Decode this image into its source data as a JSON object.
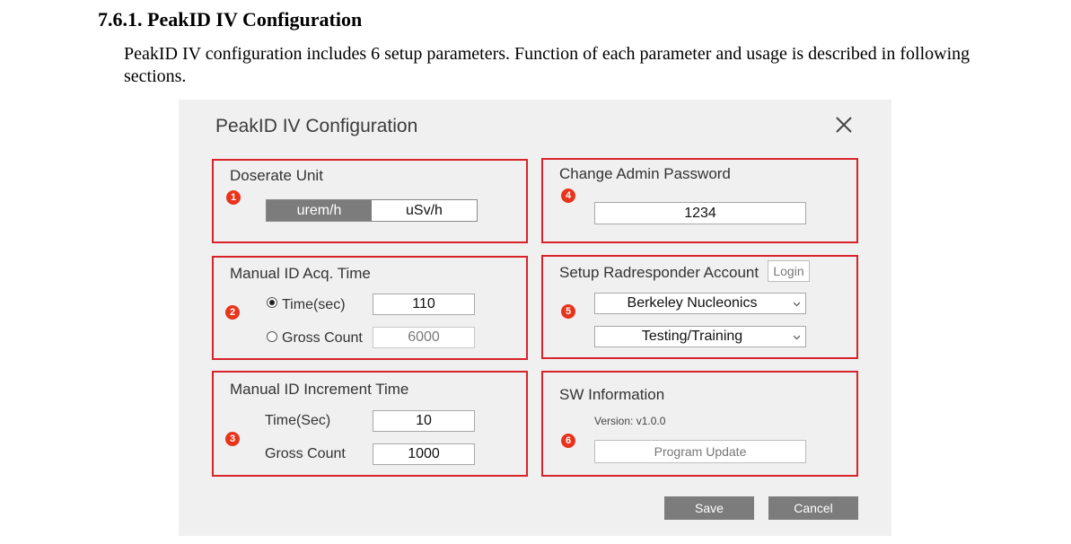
{
  "document": {
    "heading": "7.6.1. PeakID IV Configuration",
    "paragraph": "PeakID IV configuration includes 6 setup parameters. Function of each parameter and usage is described in following sections."
  },
  "dialog": {
    "title": "PeakID IV Configuration",
    "close_icon": "close-icon",
    "sections": {
      "doserate": {
        "title": "Doserate Unit",
        "badge": "1",
        "options": [
          "urem/h",
          "uSv/h"
        ],
        "selected": "urem/h"
      },
      "acq_time": {
        "title": "Manual ID Acq. Time",
        "badge": "2",
        "time_label": "Time(sec)",
        "time_value": "110",
        "gross_label": "Gross Count",
        "gross_value": "6000",
        "selected_option": "Time(sec)"
      },
      "increment": {
        "title": "Manual ID Increment Time",
        "badge": "3",
        "time_label": "Time(Sec)",
        "time_value": "10",
        "gross_label": "Gross Count",
        "gross_value": "1000"
      },
      "admin_password": {
        "title": "Change Admin Password",
        "badge": "4",
        "value": "1234"
      },
      "radresponder": {
        "title": "Setup Radresponder Account",
        "badge": "5",
        "login_label": "Login",
        "organization": "Berkeley Nucleonics",
        "event": "Testing/Training"
      },
      "sw_info": {
        "title": "SW Information",
        "badge": "6",
        "version": "Version: v1.0.0",
        "update_label": "Program Update"
      }
    },
    "buttons": {
      "save": "Save",
      "cancel": "Cancel"
    }
  },
  "colors": {
    "highlight_border": "#d8232a",
    "badge": "#e8341c",
    "dialog_bg": "#f0f0f0",
    "button_bg": "#7c7c7c"
  }
}
